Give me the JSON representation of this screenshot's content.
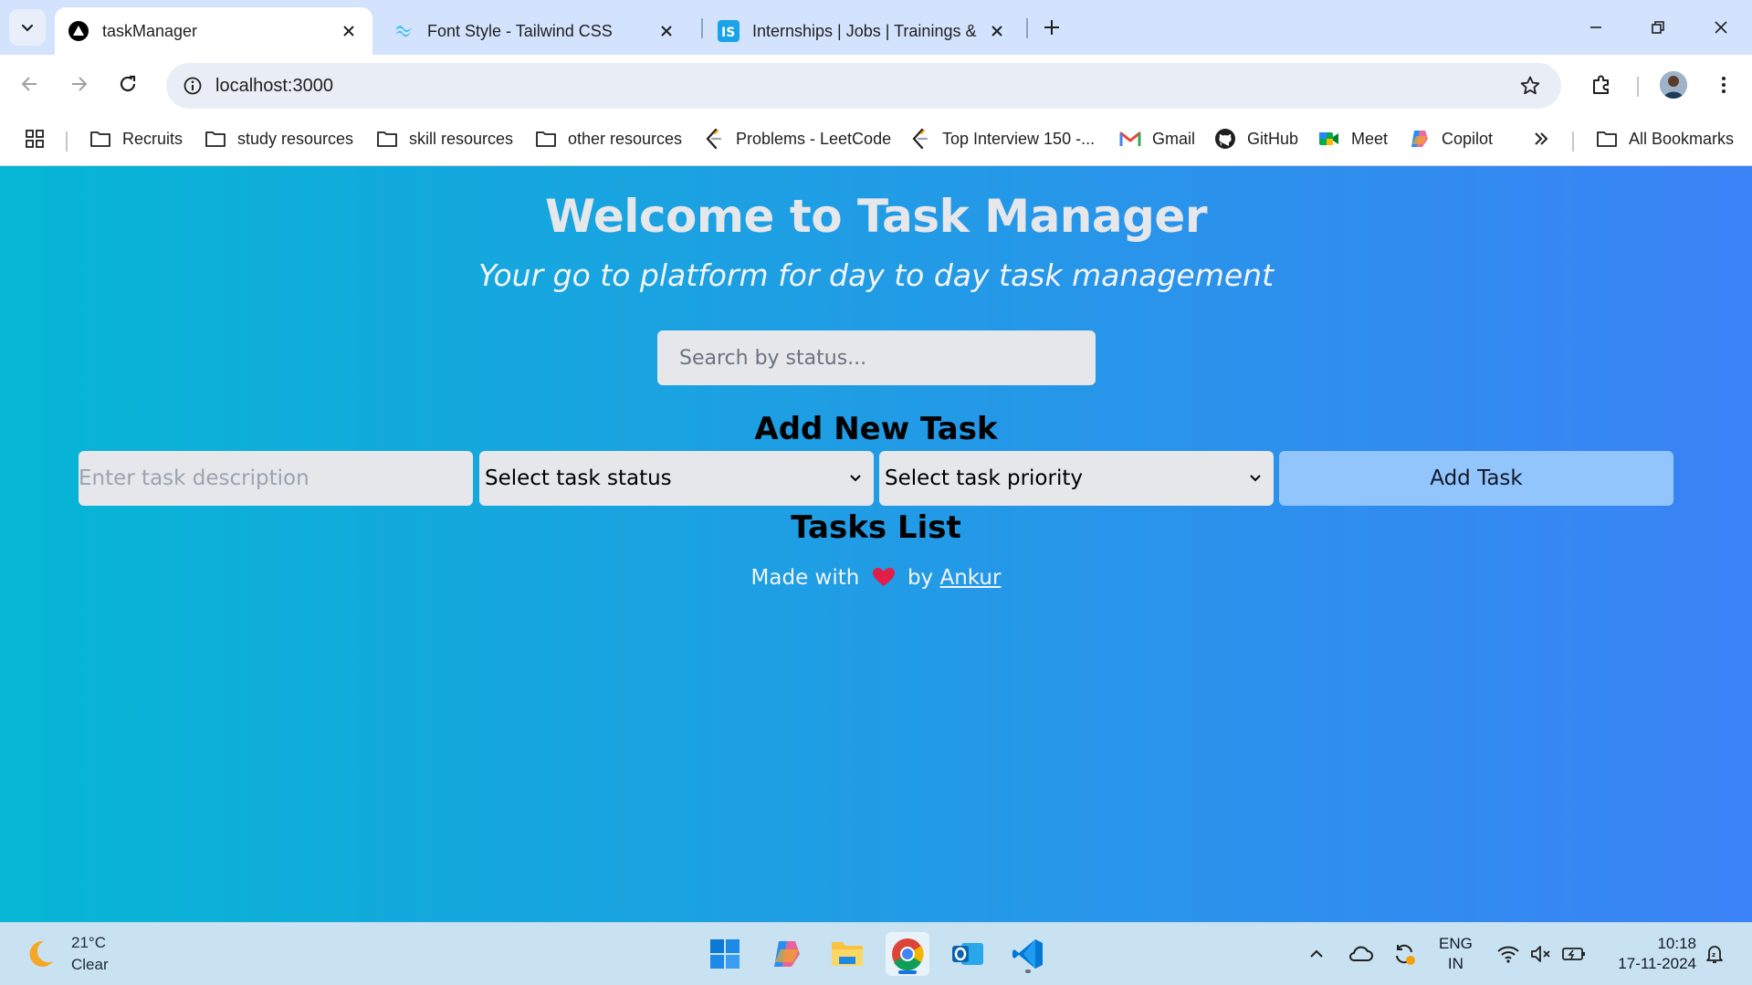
{
  "browser": {
    "tabs": [
      {
        "title": "taskManager",
        "active": true
      },
      {
        "title": "Font Style - Tailwind CSS",
        "active": false
      },
      {
        "title": "Internships | Jobs | Trainings & I",
        "active": false
      }
    ],
    "url": "localhost:3000",
    "bookmarks": [
      {
        "label": "Recruits",
        "icon": "folder-icon"
      },
      {
        "label": "study resources",
        "icon": "folder-icon"
      },
      {
        "label": "skill resources",
        "icon": "folder-icon"
      },
      {
        "label": "other resources",
        "icon": "folder-icon"
      },
      {
        "label": "Problems - LeetCode",
        "icon": "leetcode-icon"
      },
      {
        "label": "Top Interview 150 -...",
        "icon": "leetcode-icon"
      },
      {
        "label": "Gmail",
        "icon": "gmail-icon"
      },
      {
        "label": "GitHub",
        "icon": "github-icon"
      },
      {
        "label": "Meet",
        "icon": "meet-icon"
      },
      {
        "label": "Copilot",
        "icon": "copilot-icon"
      }
    ],
    "all_bookmarks_label": "All Bookmarks"
  },
  "page": {
    "title": "Welcome to Task Manager",
    "subtitle": "Your go to platform for day to day task management",
    "search_placeholder": "Search by status...",
    "add_heading": "Add New Task",
    "description_placeholder": "Enter task description",
    "status_select": "Select task status",
    "priority_select": "Select task priority",
    "add_button": "Add Task",
    "list_heading": "Tasks List",
    "footer_prefix": "Made with",
    "footer_by": "by",
    "footer_author": "Ankur",
    "gradient": [
      "#06b6d4",
      "#3b82f6"
    ]
  },
  "taskbar": {
    "temperature": "21°C",
    "condition": "Clear",
    "lang_top": "ENG",
    "lang_bottom": "IN",
    "time": "10:18",
    "date": "17-11-2024"
  }
}
